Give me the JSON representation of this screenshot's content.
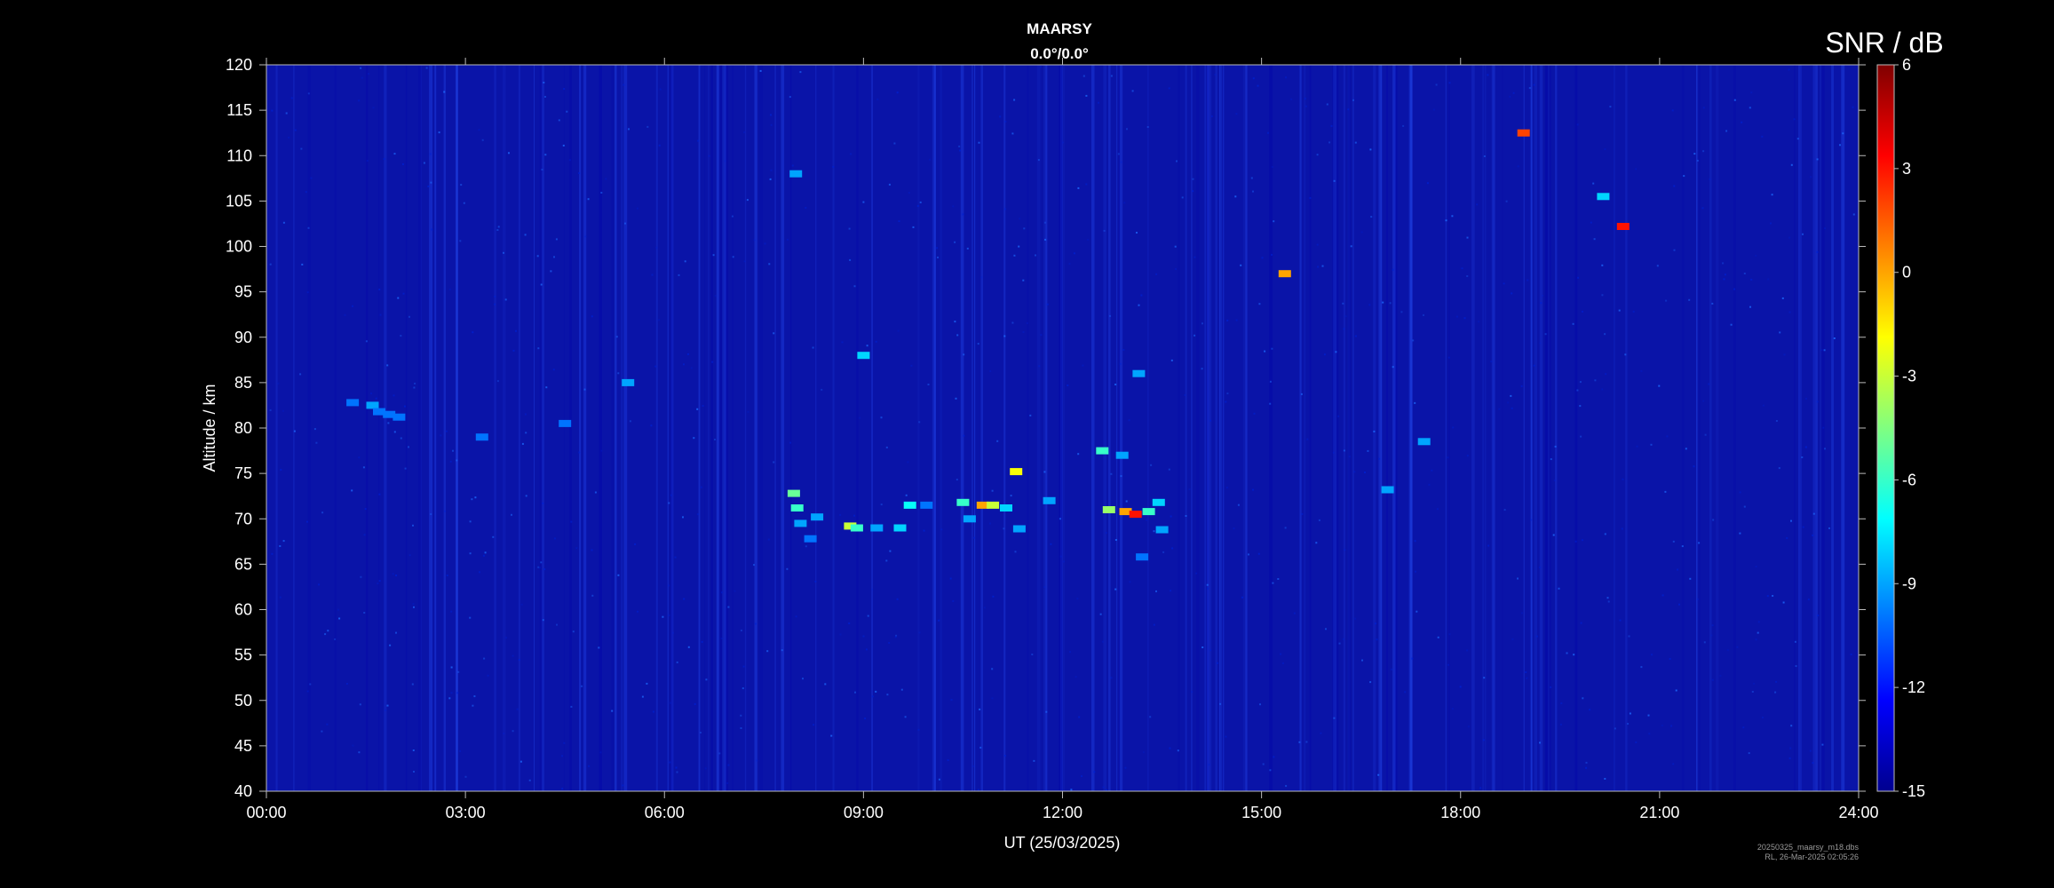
{
  "chart_data": {
    "type": "heatmap",
    "title": "MAARSY",
    "subtitle": "0.0°/0.0°",
    "xlabel": "UT (25/03/2025)",
    "ylabel": "Altitude / km",
    "xlim": [
      0,
      24
    ],
    "ylim": [
      40,
      120
    ],
    "x_tick_labels": [
      "00:00",
      "03:00",
      "06:00",
      "09:00",
      "12:00",
      "15:00",
      "18:00",
      "21:00",
      "24:00"
    ],
    "x_ticks_hours": [
      0,
      3,
      6,
      9,
      12,
      15,
      18,
      21,
      24
    ],
    "y_ticks": [
      40,
      45,
      50,
      55,
      60,
      65,
      70,
      75,
      80,
      85,
      90,
      95,
      100,
      105,
      110,
      115,
      120
    ],
    "colorbar": {
      "label": "SNR / dB",
      "range": [
        -15,
        6
      ],
      "ticks": [
        -15,
        -12,
        -9,
        -6,
        -3,
        0,
        3,
        6
      ],
      "colormap": [
        "#00008f",
        "#0000ff",
        "#0080ff",
        "#00ffff",
        "#80ff80",
        "#ffff00",
        "#ff8000",
        "#ff0000",
        "#800000"
      ]
    },
    "background_snr_db": -13.5,
    "echoes": [
      {
        "t": 1.3,
        "alt": 82.8,
        "snr": -10
      },
      {
        "t": 1.6,
        "alt": 82.5,
        "snr": -9
      },
      {
        "t": 1.7,
        "alt": 81.8,
        "snr": -10
      },
      {
        "t": 1.85,
        "alt": 81.5,
        "snr": -10
      },
      {
        "t": 2.0,
        "alt": 81.2,
        "snr": -10
      },
      {
        "t": 3.25,
        "alt": 79.0,
        "snr": -10
      },
      {
        "t": 4.5,
        "alt": 80.5,
        "snr": -10
      },
      {
        "t": 5.45,
        "alt": 85.0,
        "snr": -9
      },
      {
        "t": 7.95,
        "alt": 72.8,
        "snr": -5
      },
      {
        "t": 8.0,
        "alt": 71.2,
        "snr": -6
      },
      {
        "t": 8.05,
        "alt": 69.5,
        "snr": -9
      },
      {
        "t": 8.3,
        "alt": 70.2,
        "snr": -9
      },
      {
        "t": 8.2,
        "alt": 67.8,
        "snr": -10
      },
      {
        "t": 8.8,
        "alt": 69.2,
        "snr": -3
      },
      {
        "t": 8.9,
        "alt": 69.0,
        "snr": -6
      },
      {
        "t": 9.2,
        "alt": 69.0,
        "snr": -9
      },
      {
        "t": 9.55,
        "alt": 69.0,
        "snr": -8
      },
      {
        "t": 9.7,
        "alt": 71.5,
        "snr": -7
      },
      {
        "t": 9.95,
        "alt": 71.5,
        "snr": -10
      },
      {
        "t": 10.5,
        "alt": 71.8,
        "snr": -6
      },
      {
        "t": 10.8,
        "alt": 71.5,
        "snr": 0
      },
      {
        "t": 10.95,
        "alt": 71.5,
        "snr": -3
      },
      {
        "t": 11.15,
        "alt": 71.2,
        "snr": -8
      },
      {
        "t": 10.6,
        "alt": 70.0,
        "snr": -9
      },
      {
        "t": 11.3,
        "alt": 75.2,
        "snr": -2
      },
      {
        "t": 11.35,
        "alt": 68.9,
        "snr": -9
      },
      {
        "t": 11.8,
        "alt": 72.0,
        "snr": -9
      },
      {
        "t": 12.6,
        "alt": 77.5,
        "snr": -6
      },
      {
        "t": 12.9,
        "alt": 77.0,
        "snr": -9
      },
      {
        "t": 12.7,
        "alt": 71.0,
        "snr": -4
      },
      {
        "t": 12.95,
        "alt": 70.8,
        "snr": 0
      },
      {
        "t": 13.1,
        "alt": 70.5,
        "snr": 3
      },
      {
        "t": 13.3,
        "alt": 70.8,
        "snr": -6
      },
      {
        "t": 13.45,
        "alt": 71.8,
        "snr": -8
      },
      {
        "t": 13.5,
        "alt": 68.8,
        "snr": -9
      },
      {
        "t": 13.2,
        "alt": 65.8,
        "snr": -10
      },
      {
        "t": 13.15,
        "alt": 86.0,
        "snr": -9
      },
      {
        "t": 7.98,
        "alt": 108.0,
        "snr": -9
      },
      {
        "t": 9.0,
        "alt": 88.0,
        "snr": -8
      },
      {
        "t": 16.9,
        "alt": 73.2,
        "snr": -9
      },
      {
        "t": 17.45,
        "alt": 78.5,
        "snr": -9
      },
      {
        "t": 20.15,
        "alt": 105.5,
        "snr": -8
      },
      {
        "t": 20.45,
        "alt": 102.2,
        "snr": 3
      },
      {
        "t": 18.95,
        "alt": 112.5,
        "snr": 2
      },
      {
        "t": 15.35,
        "alt": 97.0,
        "snr": 0
      }
    ]
  },
  "footer": {
    "file": "20250325_maarsy_m18.dbs",
    "creator": "RL, 26-Mar-2025 02:05:26"
  }
}
